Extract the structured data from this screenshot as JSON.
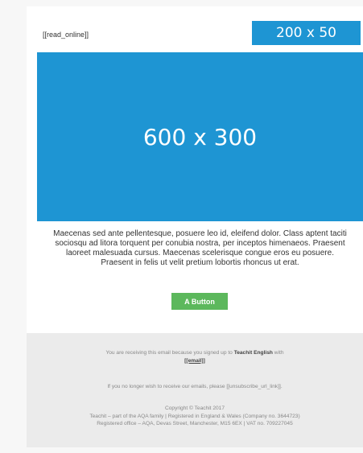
{
  "header": {
    "read_online": "[[read_online]]",
    "logo_placeholder": "200 x 50"
  },
  "hero": {
    "placeholder": "600 x 300"
  },
  "body": {
    "paragraph": "Maecenas sed ante pellentesque, posuere leo id, eleifend dolor. Class aptent taciti sociosqu ad litora torquent per conubia nostra, per inceptos himenaeos. Praesent laoreet malesuada cursus. Maecenas scelerisque congue eros eu posuere. Praesent in felis ut velit pretium lobortis rhoncus ut erat."
  },
  "cta": {
    "label": "A Button"
  },
  "footer": {
    "receiving_prefix": "You are receiving this email because you signed up to",
    "brand": "Teachit English",
    "receiving_suffix": "with",
    "email_tag": "[[email]]",
    "unsubscribe": "If you no longer wish to receive our emails, please [[unsubscribe_url_link]].",
    "copyright": "Copyright © Teachit 2017",
    "company_line": "Teachit – part of the AQA family | Registered in England & Wales (Company no. 3644723)",
    "office_line": "Registered office – AQA, Devas Street, Manchester, M15 6EX | VAT no. 709227045"
  },
  "colors": {
    "placeholder_blue": "#1e95d3",
    "button_green": "#5cb85c",
    "footer_bg": "#ebebeb",
    "page_bg": "#f7f7f7"
  }
}
